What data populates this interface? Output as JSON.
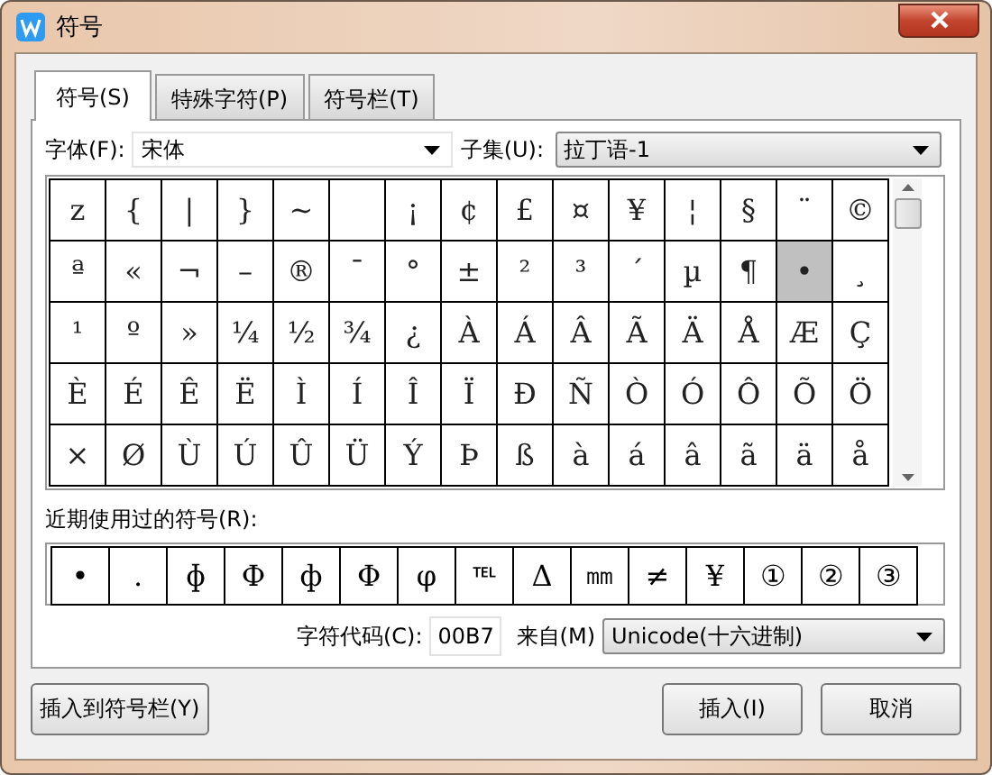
{
  "window": {
    "title": "符号"
  },
  "tabs": [
    {
      "label": "符号(S)",
      "selected": true
    },
    {
      "label": "特殊字符(P)",
      "selected": false
    },
    {
      "label": "符号栏(T)",
      "selected": false
    }
  ],
  "font": {
    "label": "字体(F):",
    "value": "宋体"
  },
  "subset": {
    "label": "子集(U):",
    "value": "拉丁语-1"
  },
  "grid": [
    [
      {
        "char": "z",
        "selected": false
      },
      {
        "char": "{",
        "selected": false
      },
      {
        "char": "|",
        "selected": false
      },
      {
        "char": "}",
        "selected": false
      },
      {
        "char": "~",
        "selected": false
      },
      {
        "selected": false
      },
      {
        "char": "¡",
        "selected": false
      },
      {
        "char": "¢",
        "selected": false
      },
      {
        "char": "£",
        "selected": false
      },
      {
        "char": "¤",
        "selected": false
      },
      {
        "char": "¥",
        "selected": false
      },
      {
        "char": "¦",
        "selected": false
      },
      {
        "char": "§",
        "selected": false
      },
      {
        "char": "¨",
        "selected": false
      },
      {
        "char": "©",
        "selected": false
      }
    ],
    [
      {
        "char": "ª",
        "selected": false
      },
      {
        "char": "«",
        "selected": false
      },
      {
        "char": "¬",
        "selected": false
      },
      {
        "char": "–",
        "selected": false
      },
      {
        "char": "®",
        "selected": false
      },
      {
        "char": "¯",
        "selected": false
      },
      {
        "char": "°",
        "selected": false
      },
      {
        "char": "±",
        "selected": false
      },
      {
        "char": "²",
        "selected": false
      },
      {
        "char": "³",
        "selected": false
      },
      {
        "char": "´",
        "selected": false
      },
      {
        "char": "µ",
        "selected": false
      },
      {
        "char": "¶",
        "selected": false
      },
      {
        "char": "•",
        "selected": true
      },
      {
        "char": "¸",
        "selected": false
      }
    ],
    [
      {
        "char": "¹",
        "selected": false
      },
      {
        "char": "º",
        "selected": false
      },
      {
        "char": "»",
        "selected": false
      },
      {
        "char": "¼",
        "selected": false
      },
      {
        "char": "½",
        "selected": false
      },
      {
        "char": "¾",
        "selected": false
      },
      {
        "char": "¿",
        "selected": false
      },
      {
        "char": "À",
        "selected": false
      },
      {
        "char": "Á",
        "selected": false
      },
      {
        "char": "Â",
        "selected": false
      },
      {
        "char": "Ã",
        "selected": false
      },
      {
        "char": "Ä",
        "selected": false
      },
      {
        "char": "Å",
        "selected": false
      },
      {
        "char": "Æ",
        "selected": false
      },
      {
        "char": "Ç",
        "selected": false
      }
    ],
    [
      {
        "char": "È",
        "selected": false
      },
      {
        "char": "É",
        "selected": false
      },
      {
        "char": "Ê",
        "selected": false
      },
      {
        "char": "Ë",
        "selected": false
      },
      {
        "char": "Ì",
        "selected": false
      },
      {
        "char": "Í",
        "selected": false
      },
      {
        "char": "Î",
        "selected": false
      },
      {
        "char": "Ï",
        "selected": false
      },
      {
        "char": "Ð",
        "selected": false
      },
      {
        "char": "Ñ",
        "selected": false
      },
      {
        "char": "Ò",
        "selected": false
      },
      {
        "char": "Ó",
        "selected": false
      },
      {
        "char": "Ô",
        "selected": false
      },
      {
        "char": "Õ",
        "selected": false
      },
      {
        "char": "Ö",
        "selected": false
      }
    ],
    [
      {
        "char": "×",
        "selected": false
      },
      {
        "char": "Ø",
        "selected": false
      },
      {
        "char": "Ù",
        "selected": false
      },
      {
        "char": "Ú",
        "selected": false
      },
      {
        "char": "Û",
        "selected": false
      },
      {
        "char": "Ü",
        "selected": false
      },
      {
        "char": "Ý",
        "selected": false
      },
      {
        "char": "Þ",
        "selected": false
      },
      {
        "char": "ß",
        "selected": false
      },
      {
        "char": "à",
        "selected": false
      },
      {
        "char": "á",
        "selected": false
      },
      {
        "char": "â",
        "selected": false
      },
      {
        "char": "ã",
        "selected": false
      },
      {
        "char": "ä",
        "selected": false
      },
      {
        "char": "å",
        "selected": false
      }
    ]
  ],
  "recent": {
    "label": "近期使用过的符号(R):",
    "symbols": [
      "•",
      ".",
      "ɸ",
      "Ф",
      "ф",
      "Φ",
      "φ",
      "℡",
      "Δ",
      "㎜",
      "≠",
      "¥",
      "①",
      "②",
      "③"
    ]
  },
  "code": {
    "label": "字符代码(C):",
    "value": "00B7"
  },
  "from": {
    "label": "来自(M)",
    "value": "Unicode(十六进制)"
  },
  "buttons": {
    "insert_to_bar": "插入到符号栏(Y)",
    "insert": "插入(I)",
    "cancel": "取消"
  }
}
